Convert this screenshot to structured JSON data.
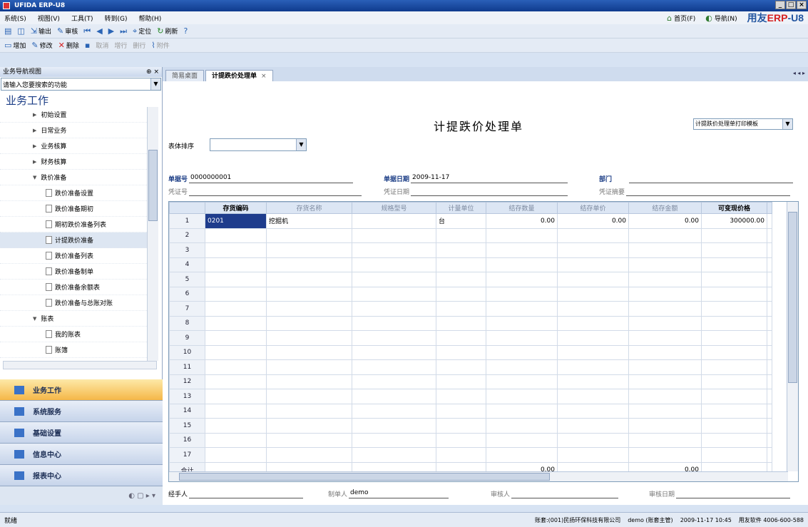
{
  "window": {
    "title": "UFIDA ERP-U8",
    "min": "_",
    "max": "□",
    "close": "×"
  },
  "menu": {
    "items": [
      "系统(S)",
      "视图(V)",
      "工具(T)",
      "转到(G)",
      "帮助(H)"
    ],
    "home": "首页(F)",
    "nav": "导航(N)",
    "brand_prefix": "用友",
    "brand_erp": "ERP",
    "brand_suffix": "-U8"
  },
  "toolbar1": [
    "输出",
    "审核",
    "定位",
    "刷新"
  ],
  "toolbar2": {
    "add": "增加",
    "edit": "修改",
    "delete": "删除",
    "cancel": "取消",
    "add_row": "增行",
    "del_row": "删行",
    "attach": "附件"
  },
  "sidebar": {
    "header": "业务导航视图",
    "pin": "⊕ ×",
    "search_placeholder": "请输入您要搜索的功能",
    "section_title": "业务工作",
    "tree": [
      {
        "label": "初始设置",
        "level": 1,
        "kind": "folder",
        "expanded": false
      },
      {
        "label": "日常业务",
        "level": 1,
        "kind": "folder",
        "expanded": false
      },
      {
        "label": "业务核算",
        "level": 1,
        "kind": "folder",
        "expanded": false
      },
      {
        "label": "财务核算",
        "level": 1,
        "kind": "folder",
        "expanded": false
      },
      {
        "label": "跌价准备",
        "level": 1,
        "kind": "folder",
        "expanded": true
      },
      {
        "label": "跌价准备设置",
        "level": 2,
        "kind": "doc"
      },
      {
        "label": "跌价准备期初",
        "level": 2,
        "kind": "doc"
      },
      {
        "label": "期初跌价准备列表",
        "level": 2,
        "kind": "doc"
      },
      {
        "label": "计提跌价准备",
        "level": 2,
        "kind": "doc",
        "selected": true
      },
      {
        "label": "跌价准备列表",
        "level": 2,
        "kind": "doc"
      },
      {
        "label": "跌价准备制单",
        "level": 2,
        "kind": "doc"
      },
      {
        "label": "跌价准备余额表",
        "level": 2,
        "kind": "doc"
      },
      {
        "label": "跌价准备与总账对账",
        "level": 2,
        "kind": "doc"
      },
      {
        "label": "账表",
        "level": 1,
        "kind": "folder",
        "expanded": true
      },
      {
        "label": "我的账表",
        "level": 2,
        "kind": "doc"
      },
      {
        "label": "账簿",
        "level": 2,
        "kind": "doc"
      }
    ],
    "outlook": [
      {
        "label": "业务工作",
        "active": true
      },
      {
        "label": "系统服务"
      },
      {
        "label": "基础设置"
      },
      {
        "label": "信息中心"
      },
      {
        "label": "报表中心"
      }
    ]
  },
  "tabs": [
    {
      "label": "简易桌面",
      "active": false
    },
    {
      "label": "计提跌价处理单",
      "active": true
    }
  ],
  "tab_close": "×",
  "tab_arrows": "◂ ◂ ▸",
  "form": {
    "title": "计提跌价处理单",
    "print_template": "计提跌价处理单打印模板",
    "sort_label": "表体排序",
    "doc_no_label": "单据号",
    "doc_no": "0000000001",
    "doc_date_label": "单据日期",
    "doc_date": "2009-11-17",
    "dept_label": "部门",
    "dept": "",
    "voucher_no_label": "凭证号",
    "voucher_date_label": "凭证日期",
    "voucher_summary_label": "凭证摘要",
    "handler_label": "经手人",
    "maker_label": "制单人",
    "maker": "demo",
    "auditor_label": "审核人",
    "audit_date_label": "审核日期"
  },
  "grid": {
    "columns": [
      "存货编码",
      "存货名称",
      "规格型号",
      "计量单位",
      "结存数量",
      "结存单价",
      "结存金额",
      "可变现价格"
    ],
    "strong_columns": [
      0,
      7
    ],
    "rows": [
      {
        "n": "1",
        "cells": [
          "0201",
          "挖掘机",
          "",
          "台",
          "0.00",
          "0.00",
          "0.00",
          "300000.00"
        ]
      },
      {
        "n": "2",
        "cells": [
          "",
          "",
          "",
          "",
          "",
          "",
          "",
          ""
        ]
      },
      {
        "n": "3",
        "cells": [
          "",
          "",
          "",
          "",
          "",
          "",
          "",
          ""
        ]
      },
      {
        "n": "4",
        "cells": [
          "",
          "",
          "",
          "",
          "",
          "",
          "",
          ""
        ]
      },
      {
        "n": "5",
        "cells": [
          "",
          "",
          "",
          "",
          "",
          "",
          "",
          ""
        ]
      },
      {
        "n": "6",
        "cells": [
          "",
          "",
          "",
          "",
          "",
          "",
          "",
          ""
        ]
      },
      {
        "n": "7",
        "cells": [
          "",
          "",
          "",
          "",
          "",
          "",
          "",
          ""
        ]
      },
      {
        "n": "8",
        "cells": [
          "",
          "",
          "",
          "",
          "",
          "",
          "",
          ""
        ]
      },
      {
        "n": "9",
        "cells": [
          "",
          "",
          "",
          "",
          "",
          "",
          "",
          ""
        ]
      },
      {
        "n": "10",
        "cells": [
          "",
          "",
          "",
          "",
          "",
          "",
          "",
          ""
        ]
      },
      {
        "n": "11",
        "cells": [
          "",
          "",
          "",
          "",
          "",
          "",
          "",
          ""
        ]
      },
      {
        "n": "12",
        "cells": [
          "",
          "",
          "",
          "",
          "",
          "",
          "",
          ""
        ]
      },
      {
        "n": "13",
        "cells": [
          "",
          "",
          "",
          "",
          "",
          "",
          "",
          ""
        ]
      },
      {
        "n": "14",
        "cells": [
          "",
          "",
          "",
          "",
          "",
          "",
          "",
          ""
        ]
      },
      {
        "n": "15",
        "cells": [
          "",
          "",
          "",
          "",
          "",
          "",
          "",
          ""
        ]
      },
      {
        "n": "16",
        "cells": [
          "",
          "",
          "",
          "",
          "",
          "",
          "",
          ""
        ]
      },
      {
        "n": "17",
        "cells": [
          "",
          "",
          "",
          "",
          "",
          "",
          "",
          ""
        ]
      }
    ],
    "total_label": "合计",
    "total_cells": [
      "",
      "",
      "",
      "",
      "0.00",
      "",
      "0.00",
      ""
    ]
  },
  "status": {
    "left": "就绪",
    "account": "账套:(001)民扬环保科技有限公司",
    "user": "demo (账套主管)",
    "date": "2009-11-17 10:45",
    "company": "用友软件 4006-600-588"
  },
  "colors": {
    "accent": "#1a3c85",
    "active_tab": "#f5b748",
    "selection": "#1e3c8c"
  }
}
